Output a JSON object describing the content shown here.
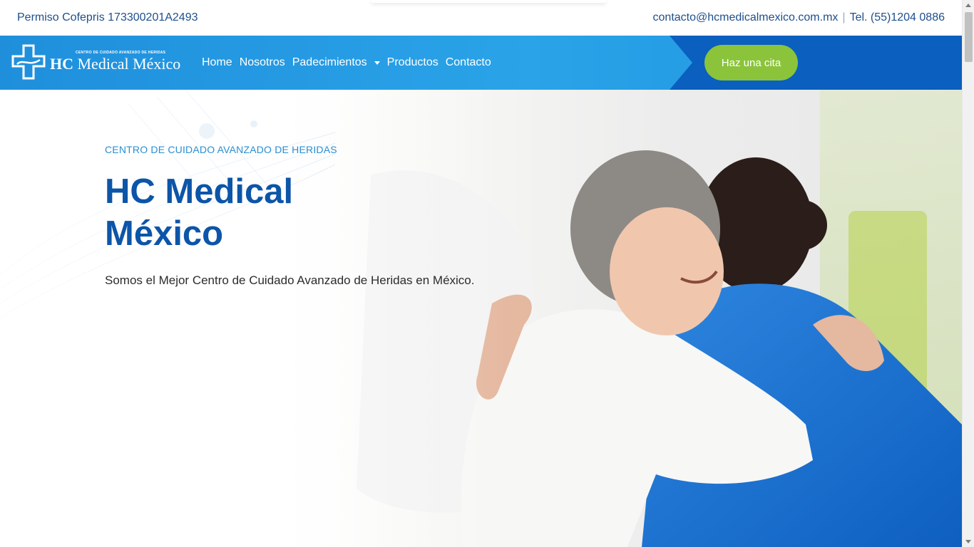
{
  "topbar": {
    "permit": "Permiso Cofepris 173300201A2493",
    "email": "contacto@hcmedicalmexico.com.mx",
    "separator": "|",
    "phone": "Tel. (55)1204 0886"
  },
  "logo": {
    "tagline": "CENTRO DE CUIDADO AVANZADO DE HERIDAS",
    "brand_bold": "HC",
    "brand_rest": "Medical México"
  },
  "nav": {
    "items": [
      {
        "label": "Home"
      },
      {
        "label": "Nosotros"
      },
      {
        "label": "Padecimientos",
        "dropdown": true
      },
      {
        "label": "Productos"
      },
      {
        "label": "Contacto"
      }
    ],
    "cta": "Haz una cita"
  },
  "hero": {
    "eyebrow": "CENTRO DE CUIDADO AVANZADO DE HERIDAS",
    "title": "HC Medical México",
    "lead": "Somos el Mejor Centro de Cuidado Avanzado de Heridas en México.",
    "image_icon": "hero-photo-nurse-hugging-patient"
  },
  "colors": {
    "nav_blue": "#2aa3e8",
    "nav_dark": "#0a5fbf",
    "cta_green": "#8bc43a",
    "title_blue": "#0c55a8",
    "eyebrow_blue": "#2a8ed1",
    "topbar_text": "#1e4f8c"
  }
}
